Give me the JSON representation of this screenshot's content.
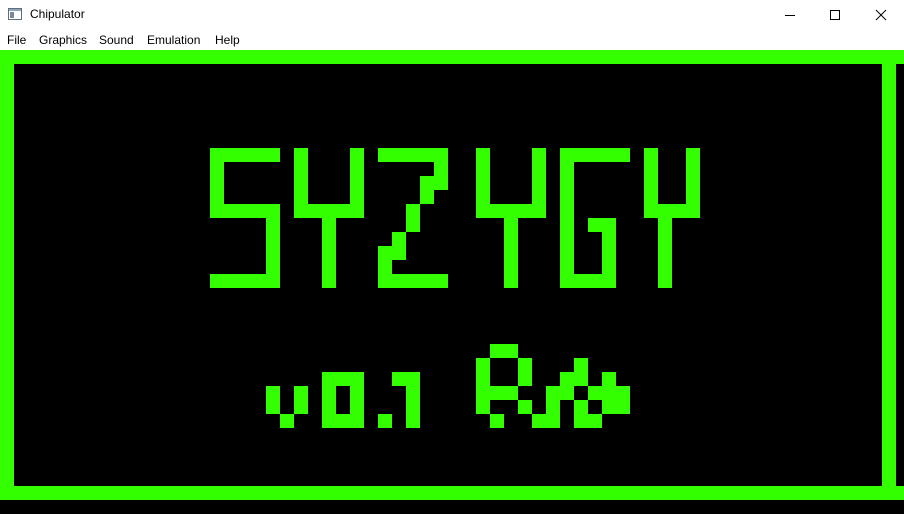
{
  "window": {
    "title": "Chipulator",
    "icon": "app-window-icon",
    "controls": [
      "minimize-icon",
      "maximize-icon",
      "close-icon"
    ]
  },
  "menu": {
    "items": [
      "File",
      "Graphics",
      "Sound",
      "Emulation",
      "Help"
    ]
  },
  "screen": {
    "colors": {
      "foreground": "#33ff00",
      "background": "#000000"
    },
    "title_text": "SYZYGY",
    "version_text": "v0.1 RB"
  }
}
